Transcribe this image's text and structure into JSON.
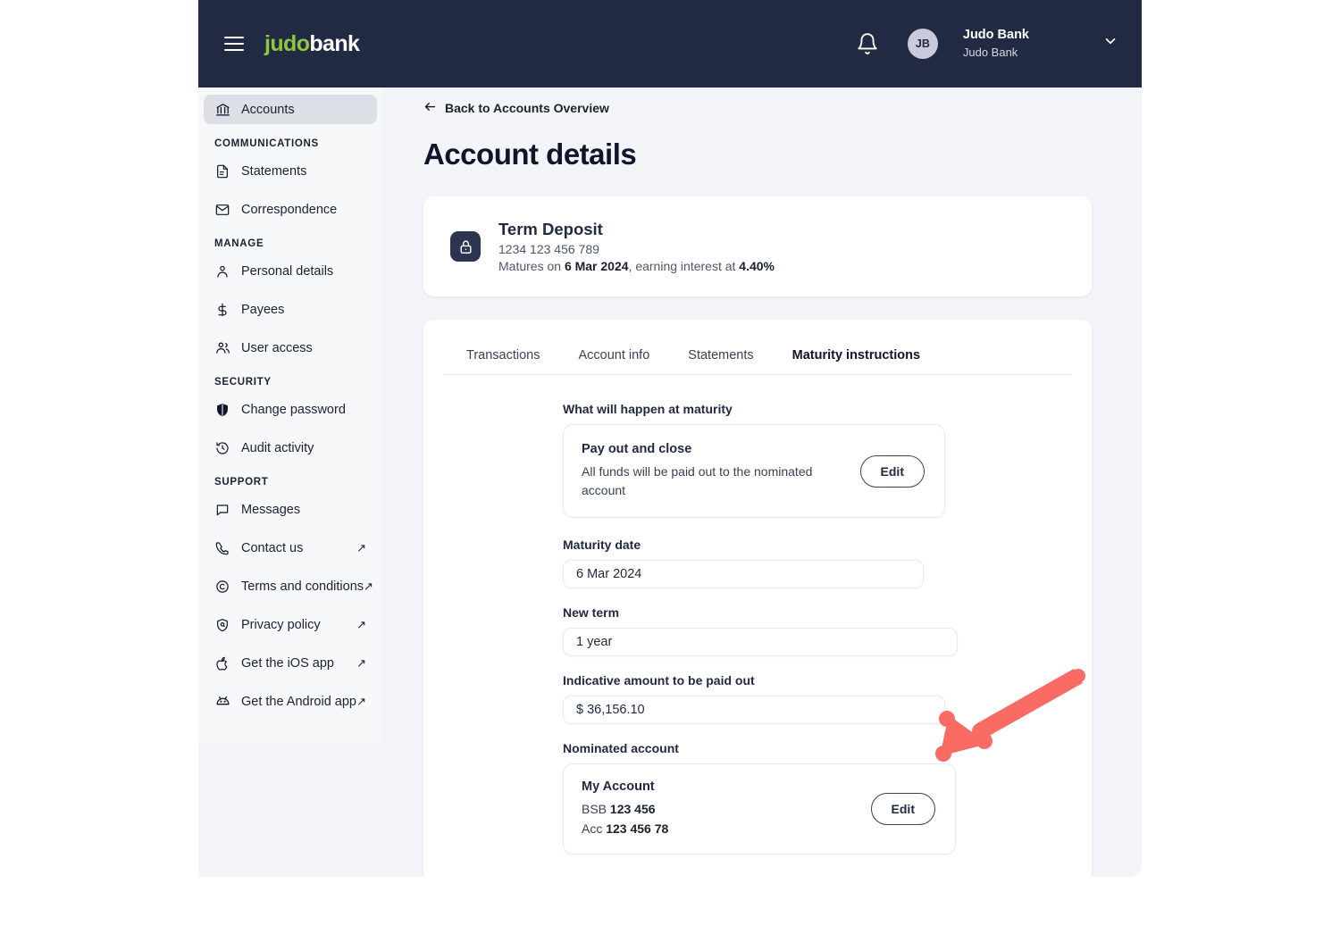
{
  "brand": {
    "logo_green": "judo",
    "logo_white": "bank"
  },
  "header": {
    "menu_icon": "hamburger-icon",
    "bell_icon": "notification-bell-icon",
    "avatar_initials": "JB",
    "user_name": "Judo Bank",
    "user_org": "Judo Bank",
    "chevron_icon": "chevron-down-icon"
  },
  "sidebar": {
    "primary": [
      {
        "label": "Accounts",
        "icon": "bank-icon",
        "active": true
      }
    ],
    "sections": [
      {
        "title": "COMMUNICATIONS",
        "items": [
          {
            "label": "Statements",
            "icon": "document-icon",
            "external": false
          },
          {
            "label": "Correspondence",
            "icon": "envelope-icon",
            "external": false
          }
        ]
      },
      {
        "title": "MANAGE",
        "items": [
          {
            "label": "Personal details",
            "icon": "person-icon",
            "external": false
          },
          {
            "label": "Payees",
            "icon": "dollar-icon",
            "external": false
          },
          {
            "label": "User access",
            "icon": "people-icon",
            "external": false
          }
        ]
      },
      {
        "title": "SECURITY",
        "items": [
          {
            "label": "Change password",
            "icon": "shield-icon",
            "external": false
          },
          {
            "label": "Audit activity",
            "icon": "history-clock-icon",
            "external": false
          }
        ]
      },
      {
        "title": "SUPPORT",
        "items": [
          {
            "label": "Messages",
            "icon": "chat-bubble-icon",
            "external": false
          },
          {
            "label": "Contact us",
            "icon": "phone-icon",
            "external": true
          },
          {
            "label": "Terms and conditions",
            "icon": "copyright-icon",
            "external": true
          },
          {
            "label": "Privacy policy",
            "icon": "privacy-shield-icon",
            "external": true
          },
          {
            "label": "Get the iOS app",
            "icon": "apple-icon",
            "external": true
          },
          {
            "label": "Get the Android app",
            "icon": "android-icon",
            "external": true
          }
        ]
      }
    ],
    "external_marker": "↗"
  },
  "main": {
    "back_link": "Back to Accounts Overview",
    "back_icon": "arrow-left-icon",
    "page_title": "Account details",
    "account": {
      "icon": "padlock-icon",
      "name": "Term Deposit",
      "number": "1234 123 456 789",
      "maturity_prefix": "Matures on ",
      "maturity_date": "6 Mar 2024",
      "maturity_middle": ", earning interest at ",
      "interest_rate": "4.40%"
    },
    "tabs": [
      {
        "label": "Transactions",
        "active": false
      },
      {
        "label": "Account info",
        "active": false
      },
      {
        "label": "Statements",
        "active": false
      },
      {
        "label": "Maturity instructions",
        "active": true
      }
    ],
    "maturity": {
      "what_happens_label": "What will happen at maturity",
      "instruction_title": "Pay out and close",
      "instruction_desc": "All funds will be paid out to the nominated account",
      "instruction_edit": "Edit",
      "maturity_date_label": "Maturity date",
      "maturity_date_value": "6 Mar 2024",
      "new_term_label": "New term",
      "new_term_value": "1 year",
      "amount_label": "Indicative amount to be paid out",
      "amount_value": "$ 36,156.10",
      "nominated_label": "Nominated account",
      "nominated_name": "My Account",
      "bsb_label": "BSB ",
      "bsb_value": "123 456",
      "acc_label": "Acc ",
      "acc_value": "123 456 78",
      "nominated_edit": "Edit"
    }
  },
  "annotation": {
    "arrow_icon": "red-arrow-pointer",
    "color": "#fa6b63"
  },
  "colors": {
    "header_navy": "#222a43",
    "logo_green": "#8dc63f",
    "page_bg": "#f2f4f7",
    "sidebar_bg": "#f7f8fa",
    "active_nav": "#dcdfe6",
    "text_dark": "#10152a",
    "arrow_red": "#fa6b63"
  }
}
